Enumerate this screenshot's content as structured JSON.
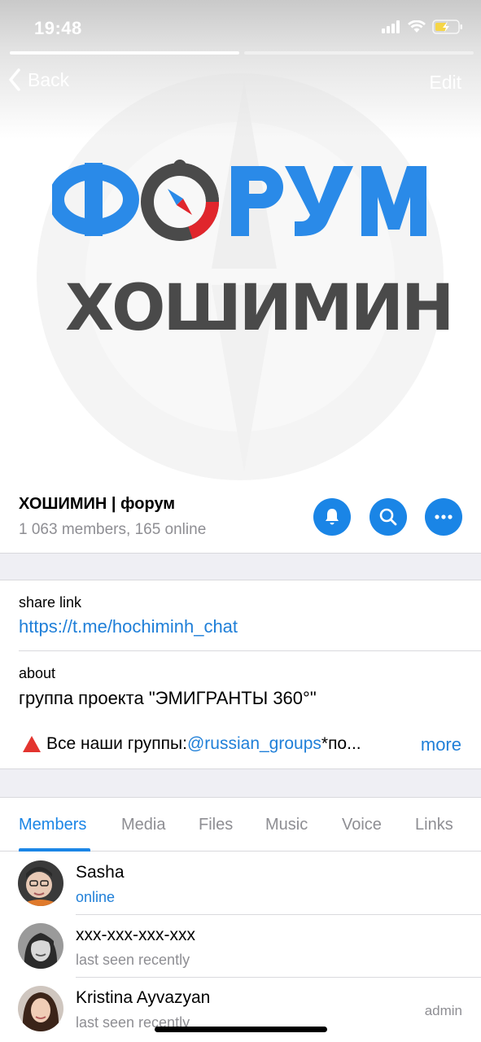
{
  "status_bar": {
    "time": "19:48"
  },
  "nav": {
    "back_label": "Back",
    "edit_label": "Edit"
  },
  "logo": {
    "line1": "ФОРУМ",
    "line2": "ХОШИМИН"
  },
  "group": {
    "title": "ХОШИМИН | форум",
    "subtitle": "1 063 members, 165 online",
    "actions": [
      {
        "icon": "bell-icon"
      },
      {
        "icon": "search-icon"
      },
      {
        "icon": "more-icon"
      }
    ]
  },
  "share": {
    "label": "share link",
    "url": "https://t.me/hochiminh_chat"
  },
  "about": {
    "label": "about",
    "line1": "группа проекта \"ЭМИГРАНТЫ 360°\"",
    "promo_prefix": "Все наши группы:",
    "promo_mention": "@russian_groups",
    "promo_suffix": "*по...",
    "more_label": "more"
  },
  "tabs": [
    "Members",
    "Media",
    "Files",
    "Music",
    "Voice",
    "Links"
  ],
  "active_tab": "Members",
  "members": [
    {
      "name": "Sasha",
      "status": "online",
      "role": ""
    },
    {
      "name": "xxx-xxx-xxx-xxx",
      "status": "last seen recently",
      "role": ""
    },
    {
      "name": "Kristina Ayvazyan",
      "status": "last seen recently",
      "role": "admin"
    }
  ],
  "colors": {
    "accent": "#1a85e6",
    "link": "#1f7fd8",
    "logo_blue": "#2a8ae8",
    "logo_gray": "#4a4a4a",
    "compass_red": "#e0262c"
  }
}
